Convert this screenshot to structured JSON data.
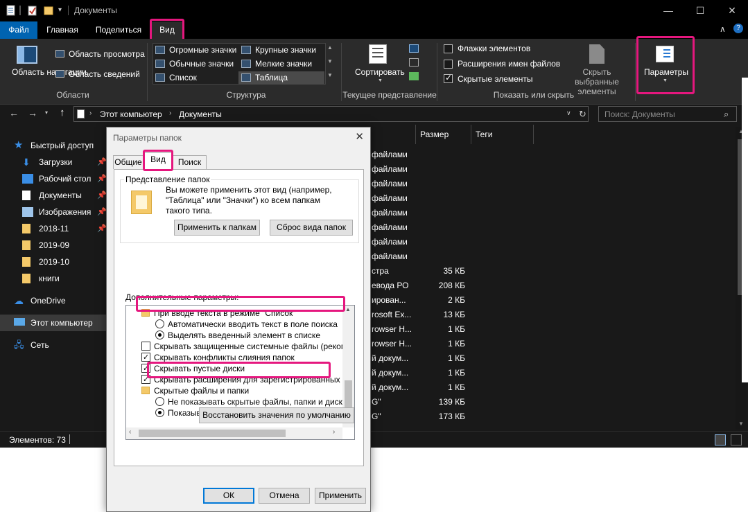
{
  "explorer": {
    "title": "Документы",
    "tabs": [
      "Файл",
      "Главная",
      "Поделиться",
      "Вид"
    ],
    "ribbon": {
      "nav_pane": "Область навигации",
      "preview_pane": "Область просмотра",
      "details_pane": "Область сведений",
      "group_panes": "Области",
      "layout": [
        "Огромные значки",
        "Крупные значки",
        "Обычные значки",
        "Мелкие значки",
        "Список",
        "Таблица"
      ],
      "group_layout": "Структура",
      "sort": "Сортировать",
      "group_current_view": "Текущее представление",
      "item_checkboxes": "Флажки элементов",
      "file_extensions": "Расширения имен файлов",
      "hidden_items": "Скрытые элементы",
      "hide_selected": "Скрыть выбранные элементы",
      "group_show_hide": "Показать или скрыть",
      "options": "Параметры"
    },
    "address": {
      "crumb1": "Этот компьютер",
      "crumb2": "Документы",
      "search_placeholder": "Поиск: Документы"
    },
    "nav": {
      "quick_access": "Быстрый доступ",
      "downloads": "Загрузки",
      "desktop": "Рабочий стол",
      "documents": "Документы",
      "pictures": "Изображения",
      "f1": "2018-11",
      "f2": "2019-09",
      "f3": "2019-10",
      "f4": "книги",
      "onedrive": "OneDrive",
      "this_pc": "Этот компьютер",
      "network": "Сеть"
    },
    "columns": {
      "size": "Размер",
      "tags": "Теги"
    },
    "rows": [
      {
        "type": "файлами",
        "size": ""
      },
      {
        "type": "файлами",
        "size": ""
      },
      {
        "type": "файлами",
        "size": ""
      },
      {
        "type": "файлами",
        "size": ""
      },
      {
        "type": "файлами",
        "size": ""
      },
      {
        "type": "файлами",
        "size": ""
      },
      {
        "type": "файлами",
        "size": ""
      },
      {
        "type": "файлами",
        "size": ""
      },
      {
        "type": "стра",
        "size": "35 КБ"
      },
      {
        "type": "евода РО",
        "size": "208 КБ"
      },
      {
        "type": "ирован...",
        "size": "2 КБ"
      },
      {
        "type": "rosoft Ex...",
        "size": "13 КБ"
      },
      {
        "type": "rowser H...",
        "size": "1 КБ"
      },
      {
        "type": "rowser H...",
        "size": "1 КБ"
      },
      {
        "type": "й докум...",
        "size": "1 КБ"
      },
      {
        "type": "й докум...",
        "size": "1 КБ"
      },
      {
        "type": "й докум...",
        "size": "1 КБ"
      },
      {
        "type": "G\"",
        "size": "139 КБ"
      },
      {
        "type": "G\"",
        "size": "173 КБ"
      }
    ],
    "status": "Элементов: 73"
  },
  "dialog": {
    "title": "Параметры папок",
    "tabs": [
      "Общие",
      "Вид",
      "Поиск"
    ],
    "folder_views_label": "Представление папок",
    "folder_views_text": [
      "Вы можете применить этот вид (например,",
      "\"Таблица\" или \"Значки\") ко всем папкам",
      "такого типа."
    ],
    "apply_to_folders": "Применить к папкам",
    "reset_folders": "Сброс вида папок",
    "advanced_label": "Дополнительные параметры:",
    "tree": [
      "При вводе текста в режиме \"Список\"",
      "Автоматически вводить текст в поле поиска",
      "Выделять введенный элемент в списке",
      "Скрывать защищенные системные файлы (рекомен,",
      "Скрывать конфликты слияния папок",
      "Скрывать пустые диски",
      "Скрывать расширения для зарегистрированных типо",
      "Скрытые файлы и папки",
      "Не показывать скрытые файлы, папки и диски",
      "Показывать скрытые файлы, папки и диски"
    ],
    "restore_defaults": "Восстановить значения по умолчанию",
    "ok": "ОК",
    "cancel": "Отмена",
    "apply": "Применить"
  },
  "colors": {
    "highlight": "#e5177e",
    "accent": "#0063b1"
  }
}
